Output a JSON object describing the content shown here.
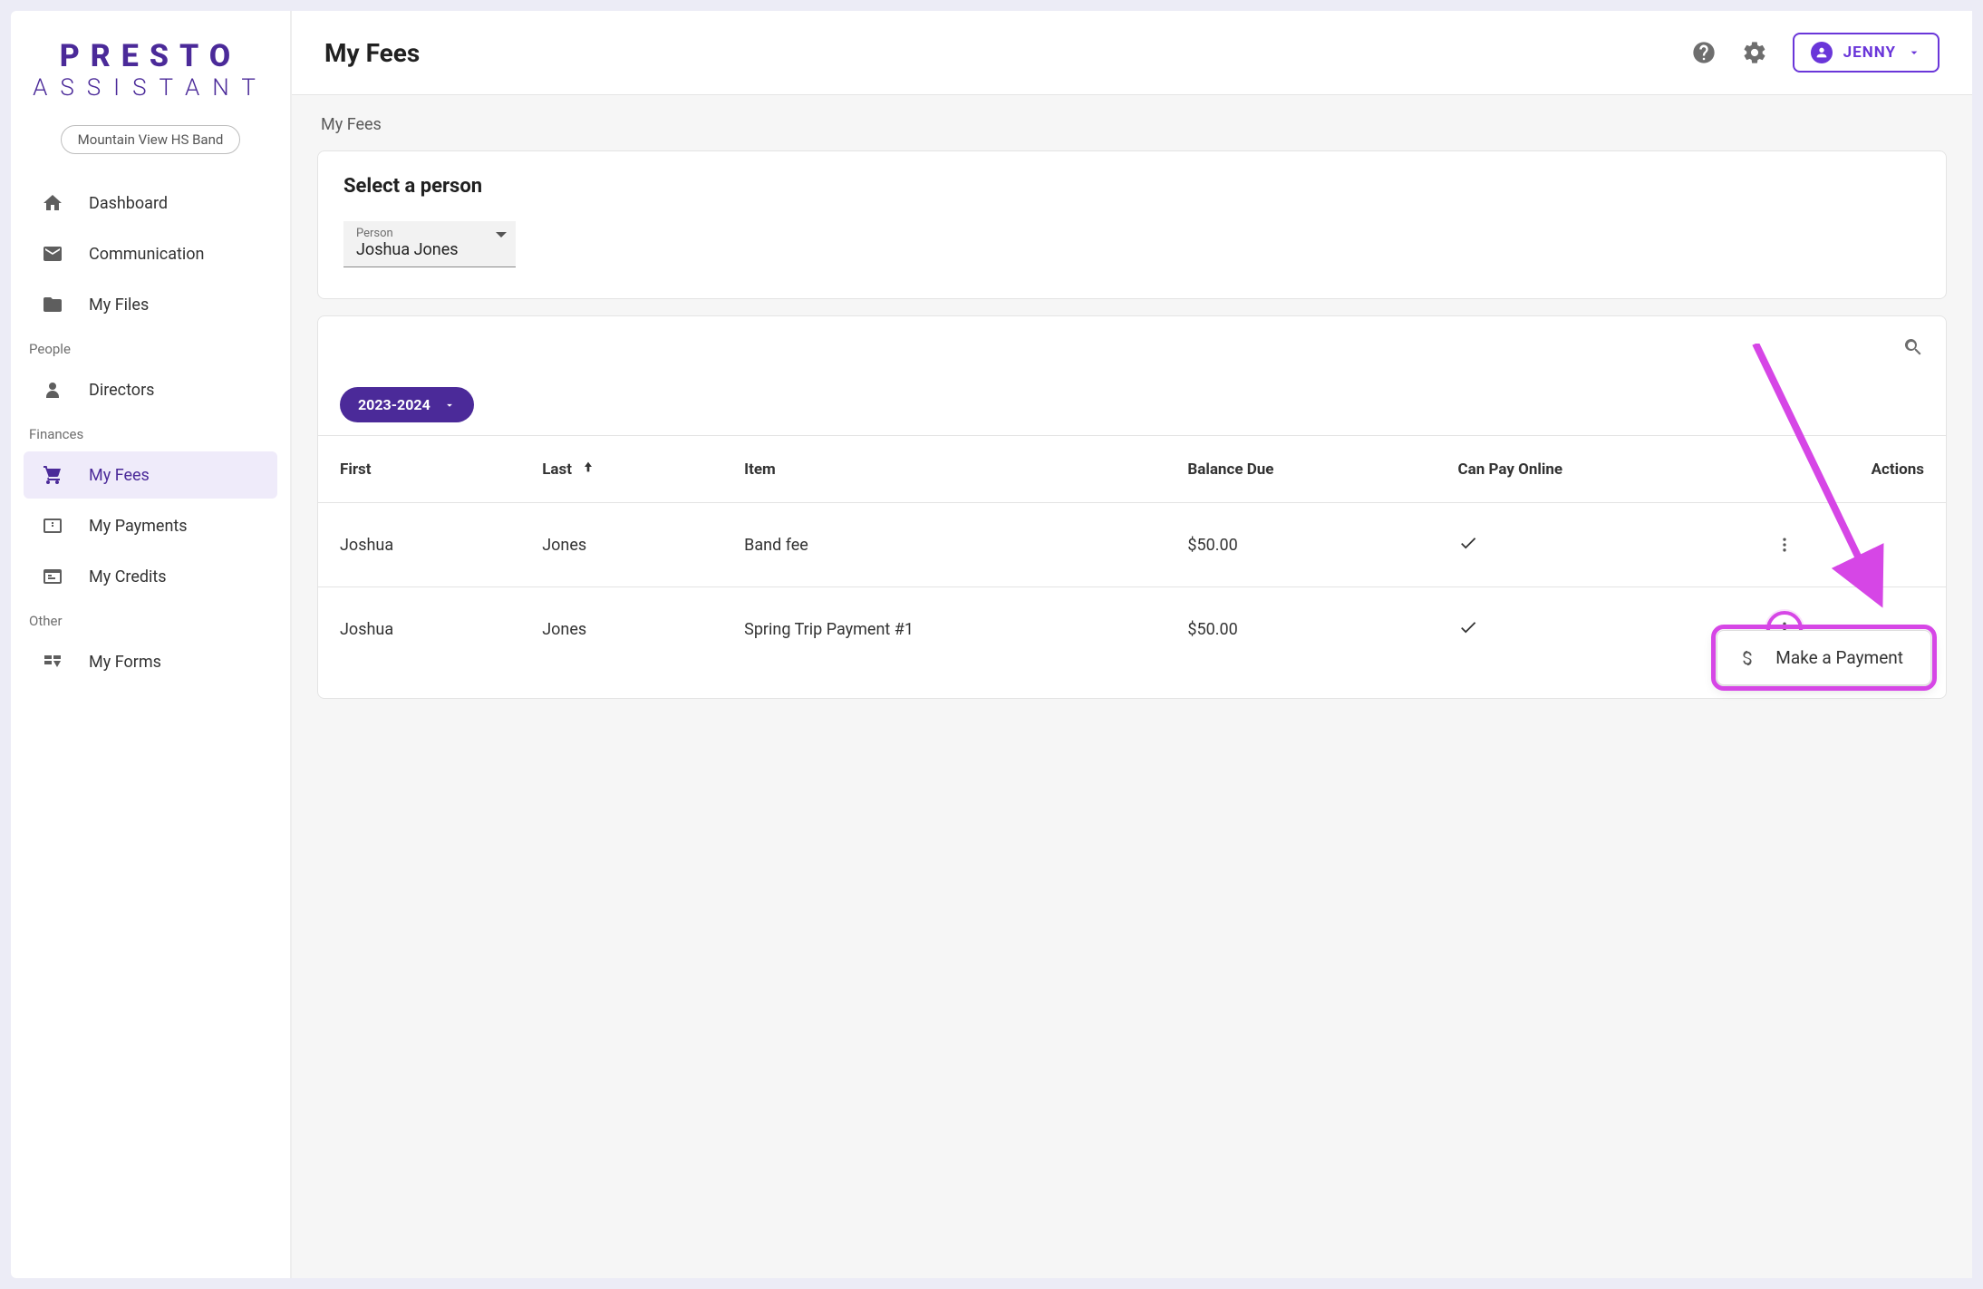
{
  "brand": {
    "line1": "PRESTO",
    "line2": "ASSISTANT"
  },
  "org": {
    "name": "Mountain View HS Band"
  },
  "sidebar": {
    "sections": [
      {
        "items": [
          {
            "label": "Dashboard",
            "icon": "home-icon"
          },
          {
            "label": "Communication",
            "icon": "mail-icon"
          },
          {
            "label": "My Files",
            "icon": "folder-icon"
          }
        ]
      },
      {
        "label": "People",
        "items": [
          {
            "label": "Directors",
            "icon": "person-icon"
          }
        ]
      },
      {
        "label": "Finances",
        "items": [
          {
            "label": "My Fees",
            "icon": "cart-icon",
            "active": true
          },
          {
            "label": "My Payments",
            "icon": "payment-icon"
          },
          {
            "label": "My Credits",
            "icon": "credit-icon"
          }
        ]
      },
      {
        "label": "Other",
        "items": [
          {
            "label": "My Forms",
            "icon": "form-icon"
          }
        ]
      }
    ]
  },
  "header": {
    "title": "My Fees",
    "user": "JENNY"
  },
  "breadcrumb": "My Fees",
  "selectPerson": {
    "title": "Select a person",
    "label": "Person",
    "value": "Joshua Jones"
  },
  "feesTable": {
    "yearLabel": "2023-2024",
    "columns": {
      "first": "First",
      "last": "Last",
      "item": "Item",
      "balance": "Balance Due",
      "online": "Can Pay Online",
      "actions": "Actions"
    },
    "rows": [
      {
        "first": "Joshua",
        "last": "Jones",
        "item": "Band fee",
        "balance": "$50.00",
        "canPayOnline": true
      },
      {
        "first": "Joshua",
        "last": "Jones",
        "item": "Spring Trip Payment #1",
        "balance": "$50.00",
        "canPayOnline": true
      }
    ],
    "menu": {
      "makePayment": "Make a Payment"
    }
  }
}
